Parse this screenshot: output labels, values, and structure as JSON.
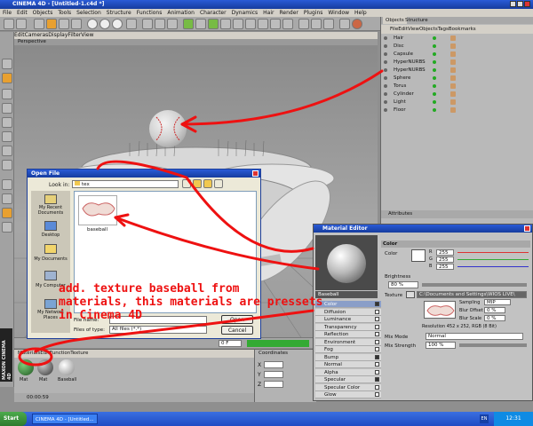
{
  "app": {
    "title": "CINEMA 4D - [Untitled-1.c4d *]"
  },
  "main_menu": [
    "File",
    "Edit",
    "Objects",
    "Tools",
    "Selection",
    "Structure",
    "Functions",
    "Animation",
    "Character",
    "Dynamics",
    "Hair",
    "Render",
    "Plugins",
    "Window",
    "Help"
  ],
  "viewport": {
    "menu": [
      "Edit",
      "Cameras",
      "Display",
      "Filter",
      "View"
    ],
    "label": "Perspective"
  },
  "object_manager": {
    "tabs": [
      "Objects",
      "Structure"
    ],
    "menu": [
      "File",
      "Edit",
      "View",
      "Objects",
      "Tags",
      "Bookmarks"
    ],
    "items": [
      "Hair",
      "Disc",
      "Capsule",
      "HyperNURBS",
      "HyperNURBS",
      "Sphere",
      "Torus",
      "Cylinder",
      "Light",
      "Floor"
    ],
    "bottom_label": "Attributes"
  },
  "open_file": {
    "title": "Open File",
    "look_in_label": "Look in:",
    "look_in_value": "tex",
    "places": [
      "My Recent Documents",
      "Desktop",
      "My Documents",
      "My Computer",
      "My Network Places"
    ],
    "file_item": "baseball",
    "file_name_label": "File name:",
    "file_type_label": "Files of type:",
    "file_type_value": "All files (*.*)",
    "open_button": "Open",
    "cancel_button": "Cancel"
  },
  "material_editor": {
    "title": "Material Editor",
    "material_name": "Baseball",
    "section_title": "Color",
    "color_label": "Color",
    "brightness_label": "Brightness",
    "brightness_value": "80 %",
    "rgb": [
      {
        "label": "R",
        "value": "255"
      },
      {
        "label": "G",
        "value": "255"
      },
      {
        "label": "B",
        "value": "255"
      }
    ],
    "texture_label": "Texture",
    "texture_path": "C:\\Documents and Settings\\WIOS LIVE\\",
    "sampling_label": "Sampling",
    "sampling_value": "MIP",
    "blur_offset_label": "Blur Offset",
    "blur_offset_value": "0 %",
    "blur_scale_label": "Blur Scale",
    "blur_scale_value": "0 %",
    "resolution": "Resolution 452 x 252, RGB (8 Bit)",
    "mix_mode_label": "Mix Mode",
    "mix_mode_value": "Normal",
    "mix_strength_label": "Mix Strength",
    "mix_strength_value": "100 %",
    "channels": [
      "Color",
      "Diffusion",
      "Luminance",
      "Transparency",
      "Reflection",
      "Environment",
      "Fog",
      "Bump",
      "Normal",
      "Alpha",
      "Specular",
      "Specular Color",
      "Glow"
    ],
    "channel_checked": [
      true,
      false,
      false,
      false,
      false,
      false,
      false,
      true,
      false,
      false,
      true,
      false,
      false
    ]
  },
  "material_manager": {
    "menu": [
      "Materials",
      "Edit",
      "Function",
      "Texture"
    ],
    "materials": [
      "Mat",
      "Mat",
      "Baseball"
    ]
  },
  "coordinates": {
    "title": "Coordinates",
    "axes": [
      "X",
      "Y",
      "Z"
    ]
  },
  "timeline": {
    "frame": "0 F",
    "time": "00:00:59"
  },
  "sidebar_brand": "MAXON CINEMA 4D",
  "annotation": {
    "lines": [
      "add. texture baseball from",
      "materials, this materials are pressets",
      "in Cinema 4D"
    ]
  },
  "taskbar": {
    "start": "Start",
    "task": "CINEMA 4D - [Untitled...",
    "lang": "EN",
    "clock": "12:31"
  },
  "colors": {
    "annotation": "#ee1111",
    "xp_blue": "#245edb",
    "start_green": "#3c9a3c"
  }
}
